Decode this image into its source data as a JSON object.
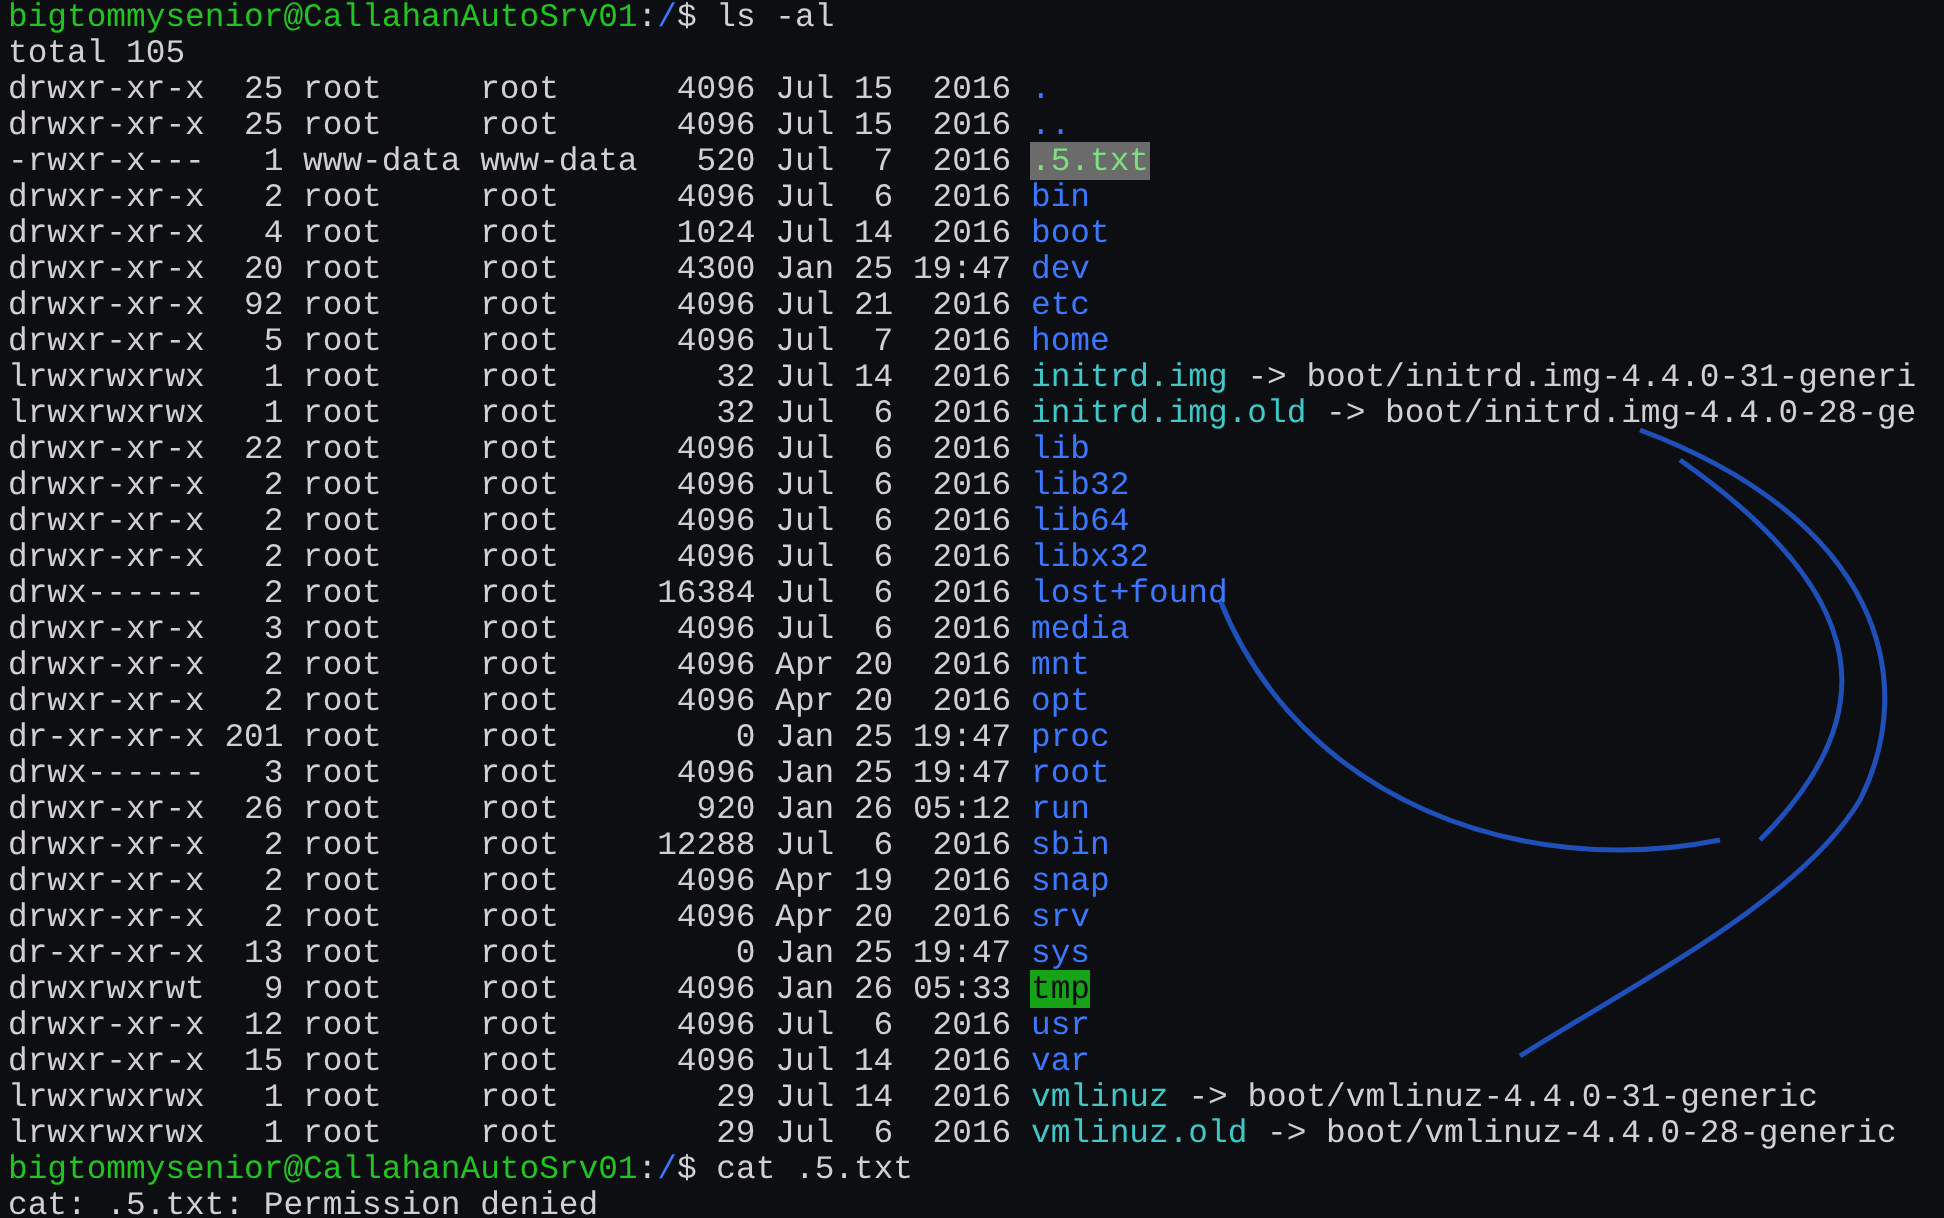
{
  "lines": [
    {
      "kind": "prompt",
      "user_host": "bigtommysenior@CallahanAutoSrv01",
      "separator": ":",
      "path": "/",
      "symbol": "$",
      "command": "ls -al"
    },
    {
      "kind": "output",
      "text": "total 105"
    },
    {
      "kind": "dir",
      "info": "drwxr-xr-x  25 root     root      4096 Jul 15  2016",
      "name": "."
    },
    {
      "kind": "dir",
      "info": "drwxr-xr-x  25 root     root      4096 Jul 15  2016",
      "name": ".."
    },
    {
      "kind": "highlighted",
      "info": "-rwxr-x---   1 www-data www-data   520 Jul  7  2016",
      "name": ".5.txt"
    },
    {
      "kind": "dir",
      "info": "drwxr-xr-x   2 root     root      4096 Jul  6  2016",
      "name": "bin"
    },
    {
      "kind": "dir",
      "info": "drwxr-xr-x   4 root     root      1024 Jul 14  2016",
      "name": "boot"
    },
    {
      "kind": "dir",
      "info": "drwxr-xr-x  20 root     root      4300 Jan 25 19:47",
      "name": "dev"
    },
    {
      "kind": "dir",
      "info": "drwxr-xr-x  92 root     root      4096 Jul 21  2016",
      "name": "etc"
    },
    {
      "kind": "dir",
      "info": "drwxr-xr-x   5 root     root      4096 Jul  7  2016",
      "name": "home"
    },
    {
      "kind": "link",
      "info": "lrwxrwxrwx   1 root     root        32 Jul 14  2016",
      "name": "initrd.img",
      "target": "-> boot/initrd.img-4.4.0-31-generi"
    },
    {
      "kind": "link",
      "info": "lrwxrwxrwx   1 root     root        32 Jul  6  2016",
      "name": "initrd.img.old",
      "target": "-> boot/initrd.img-4.4.0-28-ge"
    },
    {
      "kind": "dir",
      "info": "drwxr-xr-x  22 root     root      4096 Jul  6  2016",
      "name": "lib"
    },
    {
      "kind": "dir",
      "info": "drwxr-xr-x   2 root     root      4096 Jul  6  2016",
      "name": "lib32"
    },
    {
      "kind": "dir",
      "info": "drwxr-xr-x   2 root     root      4096 Jul  6  2016",
      "name": "lib64"
    },
    {
      "kind": "dir",
      "info": "drwxr-xr-x   2 root     root      4096 Jul  6  2016",
      "name": "libx32"
    },
    {
      "kind": "dir",
      "info": "drwx------   2 root     root     16384 Jul  6  2016",
      "name": "lost+found"
    },
    {
      "kind": "dir",
      "info": "drwxr-xr-x   3 root     root      4096 Jul  6  2016",
      "name": "media"
    },
    {
      "kind": "dir",
      "info": "drwxr-xr-x   2 root     root      4096 Apr 20  2016",
      "name": "mnt"
    },
    {
      "kind": "dir",
      "info": "drwxr-xr-x   2 root     root      4096 Apr 20  2016",
      "name": "opt"
    },
    {
      "kind": "dir",
      "info": "dr-xr-xr-x 201 root     root         0 Jan 25 19:47",
      "name": "proc"
    },
    {
      "kind": "dir",
      "info": "drwx------   3 root     root      4096 Jan 25 19:47",
      "name": "root"
    },
    {
      "kind": "dir",
      "info": "drwxr-xr-x  26 root     root       920 Jan 26 05:12",
      "name": "run"
    },
    {
      "kind": "dir",
      "info": "drwxr-xr-x   2 root     root     12288 Jul  6  2016",
      "name": "sbin"
    },
    {
      "kind": "dir",
      "info": "drwxr-xr-x   2 root     root      4096 Apr 19  2016",
      "name": "snap"
    },
    {
      "kind": "dir",
      "info": "drwxr-xr-x   2 root     root      4096 Apr 20  2016",
      "name": "srv"
    },
    {
      "kind": "dir",
      "info": "dr-xr-xr-x  13 root     root         0 Jan 25 19:47",
      "name": "sys"
    },
    {
      "kind": "sticky",
      "info": "drwxrwxrwt   9 root     root      4096 Jan 26 05:33",
      "name": "tmp"
    },
    {
      "kind": "dir",
      "info": "drwxr-xr-x  12 root     root      4096 Jul  6  2016",
      "name": "usr"
    },
    {
      "kind": "dir",
      "info": "drwxr-xr-x  15 root     root      4096 Jul 14  2016",
      "name": "var"
    },
    {
      "kind": "link",
      "info": "lrwxrwxrwx   1 root     root        29 Jul 14  2016",
      "name": "vmlinuz",
      "target": "-> boot/vmlinuz-4.4.0-31-generic"
    },
    {
      "kind": "link",
      "info": "lrwxrwxrwx   1 root     root        29 Jul  6  2016",
      "name": "vmlinuz.old",
      "target": "-> boot/vmlinuz-4.4.0-28-generic"
    },
    {
      "kind": "prompt",
      "user_host": "bigtommysenior@CallahanAutoSrv01",
      "separator": ":",
      "path": "/",
      "symbol": "$",
      "command": "cat .5.txt"
    },
    {
      "kind": "output",
      "text": "cat: .5.txt: Permission denied"
    }
  ]
}
